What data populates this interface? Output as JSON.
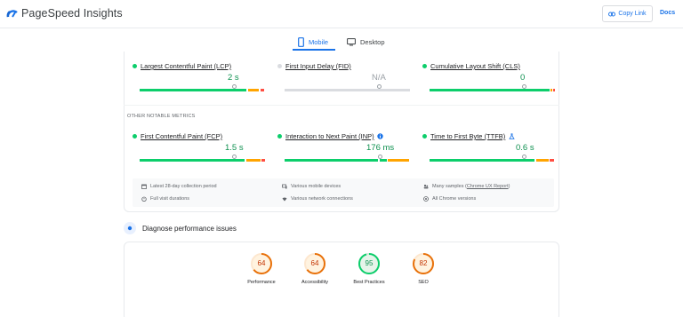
{
  "header": {
    "brand": "PageSpeed Insights",
    "copy_link": "Copy Link",
    "docs": "Docs"
  },
  "tabs": [
    {
      "label": "Mobile",
      "icon": "phone-icon",
      "active": true
    },
    {
      "label": "Desktop",
      "icon": "monitor-icon",
      "active": false
    }
  ],
  "core_metrics": [
    {
      "name": "Largest Contentful Paint (LCP)",
      "value": "2 s",
      "status": "good"
    },
    {
      "name": "First Input Delay (FID)",
      "value": "N/A",
      "status": "none"
    },
    {
      "name": "Cumulative Layout Shift (CLS)",
      "value": "0",
      "status": "good"
    }
  ],
  "section_label": "OTHER NOTABLE METRICS",
  "other_metrics": [
    {
      "name": "First Contentful Paint (FCP)",
      "value": "1.5 s",
      "status": "good"
    },
    {
      "name": "Interaction to Next Paint (INP)",
      "value": "176 ms",
      "status": "good",
      "badge": "info-icon"
    },
    {
      "name": "Time to First Byte (TTFB)",
      "value": "0.6 s",
      "status": "good",
      "badge": "experimental-icon"
    }
  ],
  "info": {
    "period": "Latest 28-day collection period",
    "devices": "Various mobile devices",
    "samples_prefix": "Many samples (",
    "samples_link": "Chrome UX Report",
    "samples_suffix": ")",
    "durations": "Full visit durations",
    "network": "Various network connections",
    "versions": "All Chrome versions"
  },
  "diagnose": {
    "title": "Diagnose performance issues"
  },
  "scores": [
    {
      "label": "Performance",
      "value": "64",
      "color": "#e8710a"
    },
    {
      "label": "Accessibility",
      "value": "64",
      "color": "#e8710a"
    },
    {
      "label": "Best Practices",
      "value": "95",
      "color": "#0d904f"
    },
    {
      "label": "SEO",
      "value": "82",
      "color": "#e8710a"
    }
  ],
  "colors": {
    "good": "#0cce6b",
    "average": "#ffa400",
    "poor": "#ff4e42",
    "accent": "#1a73e8"
  }
}
